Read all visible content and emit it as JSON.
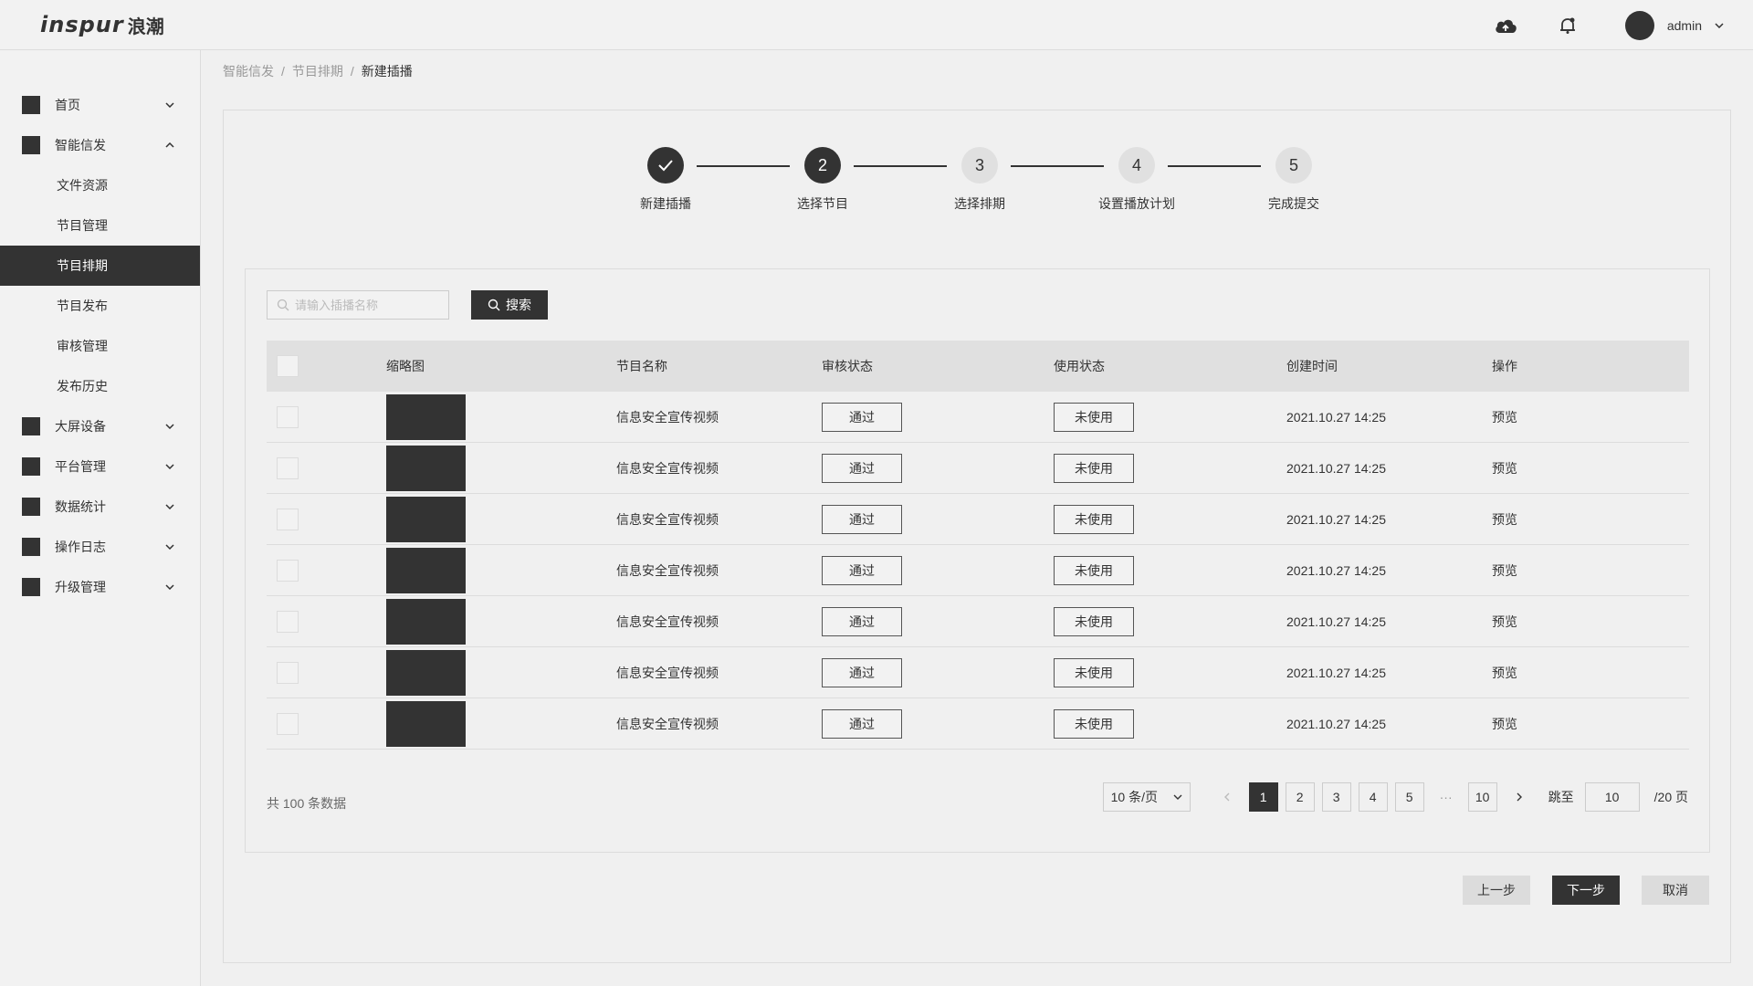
{
  "header": {
    "logo_en": "inspur",
    "logo_cn": "浪潮",
    "username": "admin"
  },
  "sidebar": {
    "items": [
      {
        "label": "首页"
      },
      {
        "label": "智能信发"
      },
      {
        "label": "大屏设备"
      },
      {
        "label": "平台管理"
      },
      {
        "label": "数据统计"
      },
      {
        "label": "操作日志"
      },
      {
        "label": "升级管理"
      }
    ],
    "sub_items": [
      {
        "label": "文件资源"
      },
      {
        "label": "节目管理"
      },
      {
        "label": "节目排期"
      },
      {
        "label": "节目发布"
      },
      {
        "label": "审核管理"
      },
      {
        "label": "发布历史"
      }
    ]
  },
  "breadcrumb": {
    "items": [
      "智能信发",
      "节目排期",
      "新建插播"
    ],
    "separator": "/"
  },
  "steps": [
    {
      "num": "",
      "label": "新建插播",
      "state": "done"
    },
    {
      "num": "2",
      "label": "选择节目",
      "state": "current"
    },
    {
      "num": "3",
      "label": "选择排期",
      "state": "todo"
    },
    {
      "num": "4",
      "label": "设置播放计划",
      "state": "todo"
    },
    {
      "num": "5",
      "label": "完成提交",
      "state": "todo"
    }
  ],
  "search": {
    "placeholder": "请输入插播名称",
    "button_label": "搜索"
  },
  "table": {
    "columns": [
      "缩略图",
      "节目名称",
      "审核状态",
      "使用状态",
      "创建时间",
      "操作"
    ],
    "rows": [
      {
        "name": "信息安全宣传视频",
        "audit": "通过",
        "use": "未使用",
        "time": "2021.10.27  14:25",
        "op": "预览"
      },
      {
        "name": "信息安全宣传视频",
        "audit": "通过",
        "use": "未使用",
        "time": "2021.10.27  14:25",
        "op": "预览"
      },
      {
        "name": "信息安全宣传视频",
        "audit": "通过",
        "use": "未使用",
        "time": "2021.10.27  14:25",
        "op": "预览"
      },
      {
        "name": "信息安全宣传视频",
        "audit": "通过",
        "use": "未使用",
        "time": "2021.10.27  14:25",
        "op": "预览"
      },
      {
        "name": "信息安全宣传视频",
        "audit": "通过",
        "use": "未使用",
        "time": "2021.10.27  14:25",
        "op": "预览"
      },
      {
        "name": "信息安全宣传视频",
        "audit": "通过",
        "use": "未使用",
        "time": "2021.10.27  14:25",
        "op": "预览"
      },
      {
        "name": "信息安全宣传视频",
        "audit": "通过",
        "use": "未使用",
        "time": "2021.10.27  14:25",
        "op": "预览"
      }
    ]
  },
  "pagination": {
    "total_text": "共 100 条数据",
    "page_size": "10 条/页",
    "pages": [
      "1",
      "2",
      "3",
      "4",
      "5"
    ],
    "ellipsis": "···",
    "last_page": "10",
    "current_page": "1",
    "jump_label": "跳至",
    "jump_value": "10",
    "pages_suffix": "/20 页"
  },
  "actions": {
    "prev_label": "上一步",
    "next_label": "下一步",
    "cancel_label": "取消"
  },
  "colors": {
    "dark": "#333333",
    "background": "#f0f0f0",
    "border": "#dcdcdc"
  }
}
